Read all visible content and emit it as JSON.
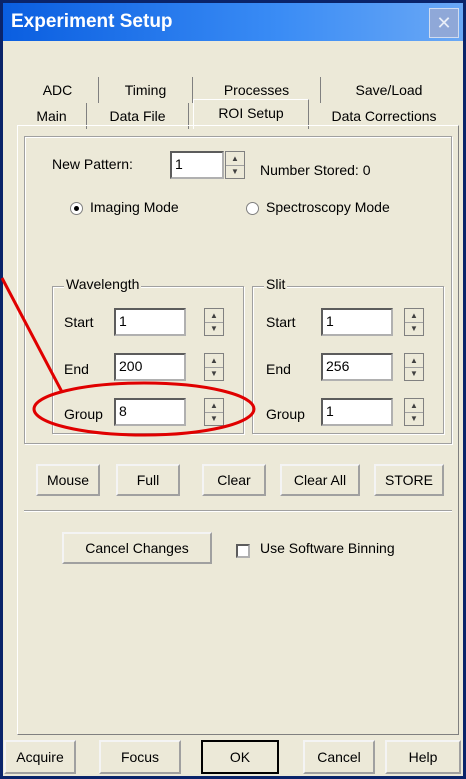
{
  "window": {
    "title": "Experiment Setup"
  },
  "tabs": {
    "row1": [
      "ADC",
      "Timing",
      "Processes",
      "Save/Load"
    ],
    "row2": [
      "Main",
      "Data File",
      "ROI Setup",
      "Data Corrections"
    ],
    "active": "ROI Setup"
  },
  "roi": {
    "new_pattern_label": "New Pattern:",
    "new_pattern_value": "1",
    "number_stored": "Number Stored: 0",
    "mode_imaging": "Imaging Mode",
    "mode_spectroscopy": "Spectroscopy Mode",
    "wavelength": {
      "title": "Wavelength",
      "start_label": "Start",
      "start": "1",
      "end_label": "End",
      "end": "200",
      "group_label": "Group",
      "group": "8"
    },
    "slit": {
      "title": "Slit",
      "start_label": "Start",
      "start": "1",
      "end_label": "End",
      "end": "256",
      "group_label": "Group",
      "group": "1"
    }
  },
  "buttons": {
    "mouse": "Mouse",
    "full": "Full",
    "clear": "Clear",
    "clear_all": "Clear All",
    "store": "STORE",
    "cancel_changes": "Cancel Changes",
    "use_software_binning": "Use Software Binning",
    "acquire": "Acquire",
    "focus": "Focus",
    "ok": "OK",
    "cancel": "Cancel",
    "help": "Help"
  },
  "colors": {
    "titlebar": "#0a5ee0",
    "annotation": "#e00000"
  }
}
